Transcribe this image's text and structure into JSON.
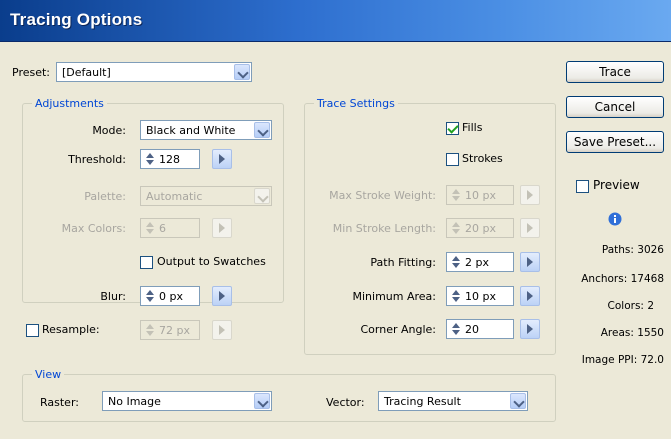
{
  "dialog": {
    "title": "Tracing Options"
  },
  "preset": {
    "label": "Preset:",
    "value": "[Default]"
  },
  "adjustments": {
    "group_label": "Adjustments",
    "mode_label": "Mode:",
    "mode_value": "Black and White",
    "threshold_label": "Threshold:",
    "threshold_value": "128",
    "palette_label": "Palette:",
    "palette_value": "Automatic",
    "max_colors_label": "Max Colors:",
    "max_colors_value": "6",
    "output_to_swatches_label": "Output to Swatches",
    "blur_label": "Blur:",
    "blur_value": "0 px",
    "resample_label": "Resample:",
    "resample_value": "72 px"
  },
  "trace_settings": {
    "group_label": "Trace Settings",
    "fills_label": "Fills",
    "fills_checked": true,
    "strokes_label": "Strokes",
    "strokes_checked": false,
    "max_stroke_weight_label": "Max Stroke Weight:",
    "max_stroke_weight_value": "10 px",
    "min_stroke_length_label": "Min Stroke Length:",
    "min_stroke_length_value": "20 px",
    "path_fitting_label": "Path Fitting:",
    "path_fitting_value": "2 px",
    "minimum_area_label": "Minimum Area:",
    "minimum_area_value": "10 px",
    "corner_angle_label": "Corner Angle:",
    "corner_angle_value": "20"
  },
  "view": {
    "group_label": "View",
    "raster_label": "Raster:",
    "raster_value": "No Image",
    "vector_label": "Vector:",
    "vector_value": "Tracing Result"
  },
  "buttons": {
    "trace": "Trace",
    "cancel": "Cancel",
    "save_preset": "Save Preset..."
  },
  "preview": {
    "label": "Preview",
    "checked": false
  },
  "stats": {
    "paths_label": "Paths:",
    "paths_value": "3026",
    "anchors_label": "Anchors:",
    "anchors_value": "17468",
    "colors_label": "Colors:",
    "colors_value": "2",
    "areas_label": "Areas:",
    "areas_value": "1550",
    "image_ppi_label": "Image PPI:",
    "image_ppi_value": "72.0"
  },
  "colors": {
    "title_bar": "#2e6fcf",
    "group_label": "#0046d5",
    "check": "#21a121"
  }
}
